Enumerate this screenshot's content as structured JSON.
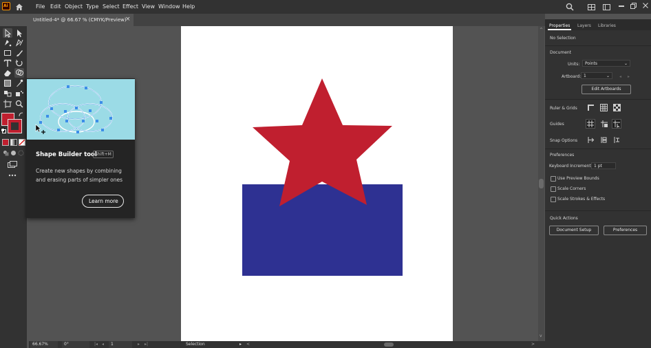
{
  "menubar": {
    "items": [
      "File",
      "Edit",
      "Object",
      "Type",
      "Select",
      "Effect",
      "View",
      "Window",
      "Help"
    ]
  },
  "document": {
    "tab_title": "Untitled-4* @ 66.67 % (CMYK/Preview)",
    "close_glyph": "×"
  },
  "tooltip": {
    "title": "Shape Builder tool",
    "shortcut": "Shift+M",
    "description_line1": "Create new shapes by combining",
    "description_line2": "and erasing parts of simpler ones",
    "learn_more": "Learn more"
  },
  "panel": {
    "tabs": [
      "Properties",
      "Layers",
      "Libraries"
    ],
    "selection": "No Selection",
    "document_heading": "Document",
    "units_label": "Units:",
    "units_value": "Points",
    "artboard_label": "Artboard:",
    "artboard_value": "1",
    "edit_artboards": "Edit Artboards",
    "ruler_grids": "Ruler & Grids",
    "guides": "Guides",
    "snap_options": "Snap Options",
    "preferences_heading": "Preferences",
    "keyboard_increment_label": "Keyboard Increment:",
    "keyboard_increment_value": "1 pt",
    "use_preview_bounds": "Use Preview Bounds",
    "scale_corners": "Scale Corners",
    "scale_strokes": "Scale Strokes & Effects",
    "quick_actions": "Quick Actions",
    "document_setup": "Document Setup",
    "preferences_button": "Preferences"
  },
  "status": {
    "zoom": "66.67%",
    "rotation": "0°",
    "artboard_num": "1",
    "tool": "Selection"
  },
  "colors": {
    "star": "#c01f2f",
    "rectangle": "#2e3192",
    "fill_swatch": "#c01f2f",
    "accent_blue": "#3c8ee8"
  },
  "app": {
    "logo": "Ai"
  }
}
